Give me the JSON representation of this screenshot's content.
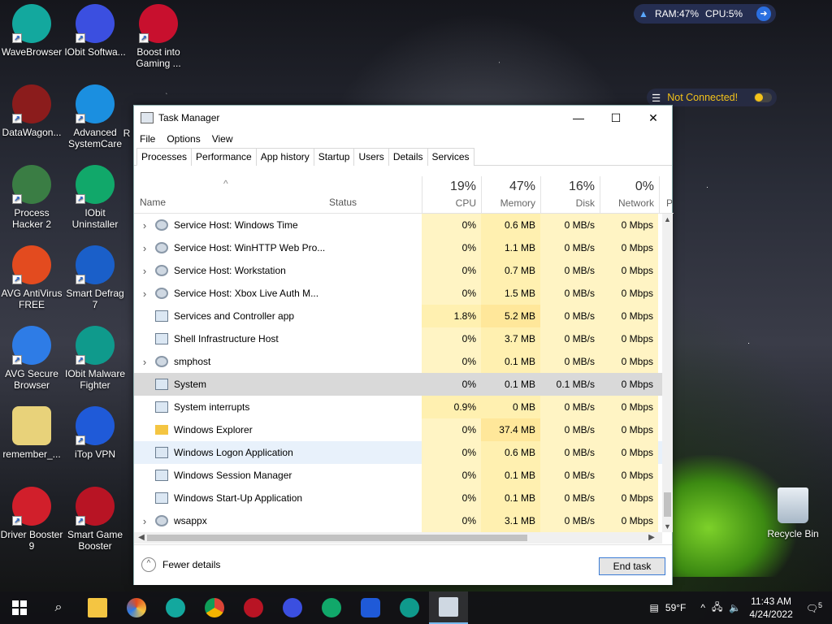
{
  "desktop": {
    "icons": [
      {
        "label": "WaveBrowser",
        "color": "#13a89e"
      },
      {
        "label": "IObit Softwa...",
        "color": "#3b4fe0"
      },
      {
        "label": "Boost into Gaming ...",
        "color": "#c8102e"
      },
      {
        "label": "DataWagon...",
        "color": "#8b1c1c"
      },
      {
        "label": "Advanced SystemCare",
        "color": "#1b8fe0"
      },
      {
        "label": "Process Hacker 2",
        "color": "#3a7d44"
      },
      {
        "label": "IObit Uninstaller",
        "color": "#11a86a"
      },
      {
        "label": "AVG AntiVirus FREE",
        "color": "#e34b1f"
      },
      {
        "label": "Smart Defrag 7",
        "color": "#1a5fc9"
      },
      {
        "label": "AVG Secure Browser",
        "color": "#2e7ce6"
      },
      {
        "label": "IObit Malware Fighter",
        "color": "#0f9a8c"
      },
      {
        "label": "remember_...",
        "color": "#e8d27a"
      },
      {
        "label": "iTop VPN",
        "color": "#1f5ad8"
      },
      {
        "label": "Driver Booster 9",
        "color": "#d11f2b"
      },
      {
        "label": "Smart Game Booster",
        "color": "#b81424"
      },
      {
        "label": "Recycle Bin",
        "color": "#b5c7d8"
      }
    ],
    "partial_label_r": "R",
    "sysmon": {
      "ram": "RAM:47%",
      "cpu": "CPU:5%"
    },
    "vpn_status": "Not Connected!"
  },
  "window": {
    "title": "Task Manager",
    "controls": {
      "minimize": "—",
      "maximize": "☐",
      "close": "✕"
    },
    "menu": [
      "File",
      "Options",
      "View"
    ],
    "tabs": [
      "Processes",
      "Performance",
      "App history",
      "Startup",
      "Users",
      "Details",
      "Services"
    ],
    "active_tab": "Processes",
    "columns": {
      "name": "Name",
      "status": "Status",
      "cpu": {
        "pct": "19%",
        "label": "CPU"
      },
      "memory": {
        "pct": "47%",
        "label": "Memory"
      },
      "disk": {
        "pct": "16%",
        "label": "Disk"
      },
      "network": {
        "pct": "0%",
        "label": "Network"
      },
      "partial": "P"
    },
    "processes": [
      {
        "name": "Service Host: Windows Time",
        "expandable": true,
        "icon": "gear",
        "cpu": "0%",
        "mem": "0.6 MB",
        "disk": "0 MB/s",
        "net": "0 Mbps"
      },
      {
        "name": "Service Host: WinHTTP Web Pro...",
        "expandable": true,
        "icon": "gear",
        "cpu": "0%",
        "mem": "1.1 MB",
        "disk": "0 MB/s",
        "net": "0 Mbps"
      },
      {
        "name": "Service Host: Workstation",
        "expandable": true,
        "icon": "gear",
        "cpu": "0%",
        "mem": "0.7 MB",
        "disk": "0 MB/s",
        "net": "0 Mbps"
      },
      {
        "name": "Service Host: Xbox Live Auth M...",
        "expandable": true,
        "icon": "gear",
        "cpu": "0%",
        "mem": "1.5 MB",
        "disk": "0 MB/s",
        "net": "0 Mbps"
      },
      {
        "name": "Services and Controller app",
        "expandable": false,
        "icon": "app",
        "cpu": "1.8%",
        "mem": "5.2 MB",
        "disk": "0 MB/s",
        "net": "0 Mbps"
      },
      {
        "name": "Shell Infrastructure Host",
        "expandable": false,
        "icon": "app",
        "cpu": "0%",
        "mem": "3.7 MB",
        "disk": "0 MB/s",
        "net": "0 Mbps"
      },
      {
        "name": "smphost",
        "expandable": true,
        "icon": "gear",
        "cpu": "0%",
        "mem": "0.1 MB",
        "disk": "0 MB/s",
        "net": "0 Mbps"
      },
      {
        "name": "System",
        "expandable": false,
        "icon": "app",
        "cpu": "0%",
        "mem": "0.1 MB",
        "disk": "0.1 MB/s",
        "net": "0 Mbps",
        "selected": true
      },
      {
        "name": "System interrupts",
        "expandable": false,
        "icon": "app",
        "cpu": "0.9%",
        "mem": "0 MB",
        "disk": "0 MB/s",
        "net": "0 Mbps"
      },
      {
        "name": "Windows Explorer",
        "expandable": false,
        "icon": "folder",
        "cpu": "0%",
        "mem": "37.4 MB",
        "disk": "0 MB/s",
        "net": "0 Mbps"
      },
      {
        "name": "Windows Logon Application",
        "expandable": false,
        "icon": "app",
        "cpu": "0%",
        "mem": "0.6 MB",
        "disk": "0 MB/s",
        "net": "0 Mbps",
        "hover": true
      },
      {
        "name": "Windows Session Manager",
        "expandable": false,
        "icon": "app",
        "cpu": "0%",
        "mem": "0.1 MB",
        "disk": "0 MB/s",
        "net": "0 Mbps"
      },
      {
        "name": "Windows Start-Up Application",
        "expandable": false,
        "icon": "app",
        "cpu": "0%",
        "mem": "0.1 MB",
        "disk": "0 MB/s",
        "net": "0 Mbps"
      },
      {
        "name": "wsappx",
        "expandable": true,
        "icon": "gear",
        "cpu": "0%",
        "mem": "3.1 MB",
        "disk": "0 MB/s",
        "net": "0 Mbps"
      }
    ],
    "footer": {
      "fewer_details": "Fewer details",
      "end_task": "End task"
    }
  },
  "taskbar": {
    "apps": [
      "start",
      "search",
      "file-explorer",
      "avg-browser",
      "wavebrowser",
      "chrome",
      "driver-booster",
      "iobit-software",
      "iobit-uninstaller",
      "itop-vpn",
      "malware-fighter",
      "task-manager"
    ],
    "weather": "59°F",
    "time": "11:43 AM",
    "date": "4/24/2022",
    "notifications": "5"
  }
}
